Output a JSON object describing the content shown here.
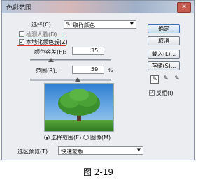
{
  "window": {
    "title": "色彩范围",
    "close_glyph": "✕"
  },
  "select": {
    "label": "选择(C):",
    "value": "取样颜色",
    "icon": "eyedropper-icon"
  },
  "detect_faces": {
    "label": "检测人脸(D)",
    "checked": false
  },
  "localized_clusters": {
    "label": "本地化颜色簇(Z)",
    "checked": true,
    "highlight_color": "#d9322b"
  },
  "fuzziness": {
    "label": "颜色容差(F):",
    "value": "35",
    "fraction": 0.175
  },
  "range": {
    "label": "范围(R):",
    "value": "59",
    "unit": "%",
    "fraction": 0.59
  },
  "preview_mode": {
    "selection_label": "选择范围(E)",
    "image_label": "图像(M)",
    "selected": "selection"
  },
  "selection_preview": {
    "label": "选区预览(T):",
    "value": "快速蒙版"
  },
  "buttons": {
    "ok": "确定",
    "cancel": "取消",
    "load": "载入(L)...",
    "save": "存储(S)..."
  },
  "tools": [
    "eyedropper-icon",
    "eyedropper-plus-icon",
    "eyedropper-minus-icon"
  ],
  "invert": {
    "label": "反相(I)",
    "checked": true
  },
  "figure_caption": "图 2-19",
  "colors": {
    "accent": "#3c6fb6",
    "dialog_bg": "#ecedf0"
  }
}
